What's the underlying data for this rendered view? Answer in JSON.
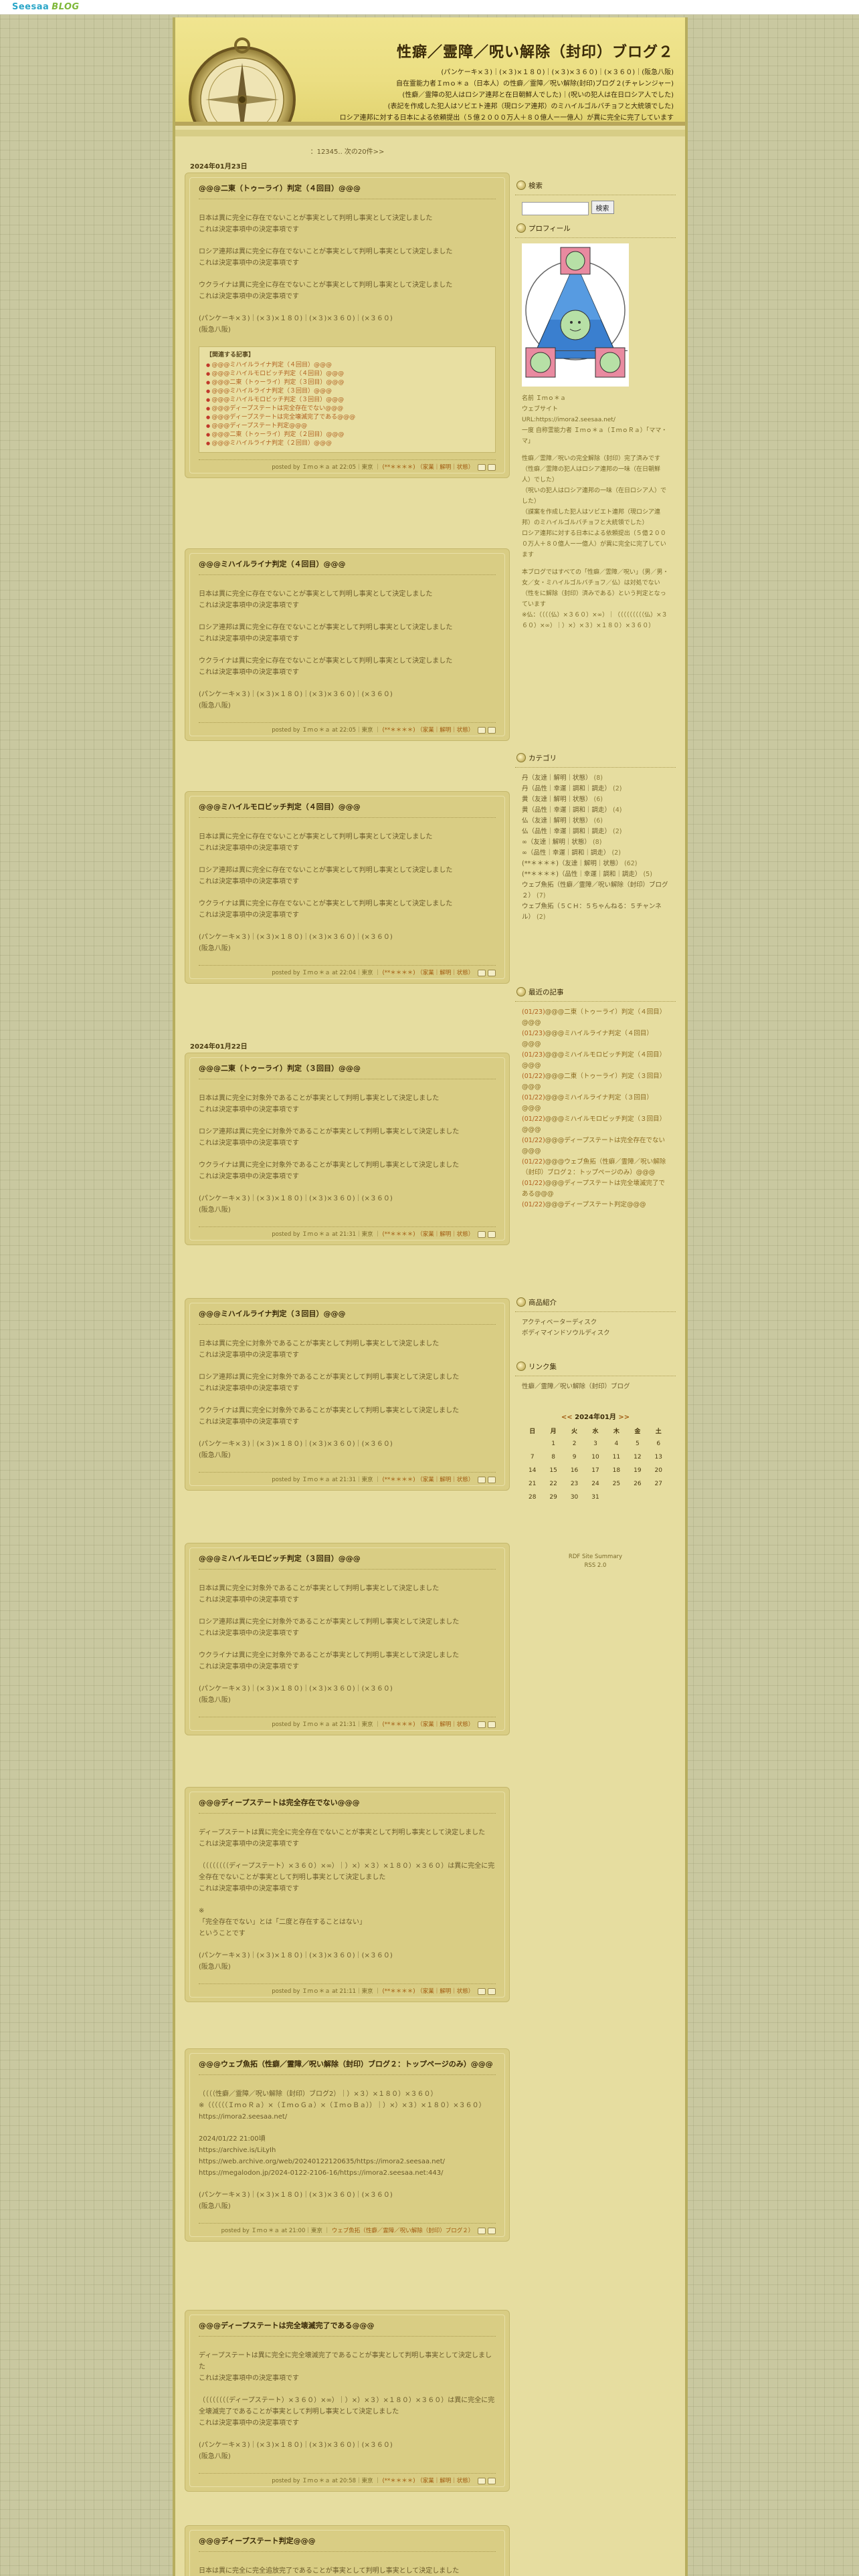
{
  "topbar": {
    "logo_part1": "Seesaa",
    "logo_part2": "BLOG"
  },
  "header": {
    "title": "性癖／霊障／呪い解除（封印）ブログ２",
    "desc": [
      "(パンケーキ×３)｜(×３)×１８０)｜(×３)×３６０)｜(×３６０)｜(阪急八阪)",
      "自在霊能力者Ｉｍｏ＊ａ（日本人）の性癖／霊障／呪い解除(封印)ブログ２(チャレンジャー)",
      "(性癖／霊障の犯人はロシア連邦と在日朝鮮人でした)｜(呪いの犯人は在日ロシア人でした)",
      "(表記を作成した犯人はソビエト連邦（現ロシア連邦）のミハイルゴルバチョフと大統領でした)",
      "ロシア連邦に対する日本による依頼提出（５億２０００万人＋８０億人ー一億人）が異に完全に完了しています"
    ]
  },
  "main": {
    "pager": "：12345.. 次の20件>>",
    "dates": [
      "2024年01月23日",
      "2024年01月22日"
    ],
    "posts": [
      {
        "title": "@@@二東（トゥーライ）判定（４回目）@@@",
        "paras": [
          [
            "日本は異に完全に存在でないことが事実として判明し事実として決定しました",
            "これは決定事項中の決定事項です"
          ],
          [
            "ロシア連邦は異に完全に存在でないことが事実として判明し事実として決定しました",
            "これは決定事項中の決定事項です"
          ],
          [
            "ウクライナは異に完全に存在でないことが事実として判明し事実として決定しました",
            "これは決定事項中の決定事項です"
          ],
          [
            "(パンケーキ×３)｜(×３)×１８０)｜(×３)×３６０)｜(×３６０)",
            "(阪急八阪)"
          ]
        ],
        "related_head": "【関連する記事】",
        "related": [
          "@@@ミハイルライナ判定（４回目）@@@",
          "@@@ミハイルモロビッチ判定（４回目）@@@",
          "@@@二東（トゥーライ）判定（３回目）@@@",
          "@@@ミハイルライナ判定（３回目）@@@",
          "@@@ミハイルモロビッチ判定（３回目）@@@",
          "@@@ディープステートは完全存在でない@@@",
          "@@@ディープステートは完全壊滅完了である@@@",
          "@@@ディープステート判定@@@",
          "@@@二東（トゥーライ）判定（２回目）@@@",
          "@@@ミハイルライナ判定（２回目）@@@"
        ],
        "foot": "posted by Ｉｍｏ＊ａ at 22:05｜東京 ｜",
        "foot_tag": "(**＊＊＊＊)",
        "foot_cat": "（家業｜解明｜状態）"
      },
      {
        "title": "@@@ミハイルライナ判定（４回目）@@@",
        "paras": [
          [
            "日本は異に完全に存在でないことが事実として判明し事実として決定しました",
            "これは決定事項中の決定事項です"
          ],
          [
            "ロシア連邦は異に完全に存在でないことが事実として判明し事実として決定しました",
            "これは決定事項中の決定事項です"
          ],
          [
            "ウクライナは異に完全に存在でないことが事実として判明し事実として決定しました",
            "これは決定事項中の決定事項です"
          ],
          [
            "(パンケーキ×３)｜(×３)×１８０)｜(×３)×３６０)｜(×３６０)",
            "(阪急八阪)"
          ]
        ],
        "foot": "posted by Ｉｍｏ＊ａ at 22:05｜東京 ｜",
        "foot_tag": "(**＊＊＊＊)",
        "foot_cat": "（家業｜解明｜状態）"
      },
      {
        "title": "@@@ミハイルモロビッチ判定（４回目）@@@",
        "paras": [
          [
            "日本は異に完全に存在でないことが事実として判明し事実として決定しました",
            "これは決定事項中の決定事項です"
          ],
          [
            "ロシア連邦は異に完全に存在でないことが事実として判明し事実として決定しました",
            "これは決定事項中の決定事項です"
          ],
          [
            "ウクライナは異に完全に存在でないことが事実として判明し事実として決定しました",
            "これは決定事項中の決定事項です"
          ],
          [
            "(パンケーキ×３)｜(×３)×１８０)｜(×３)×３６０)｜(×３６０)",
            "(阪急八阪)"
          ]
        ],
        "foot": "posted by Ｉｍｏ＊ａ at 22:04｜東京 ｜",
        "foot_tag": "(**＊＊＊＊)",
        "foot_cat": "（家業｜解明｜状態）"
      },
      {
        "title": "@@@二東（トゥーライ）判定（３回目）@@@",
        "paras": [
          [
            "日本は異に完全に対象外であることが事実として判明し事実として決定しました",
            "これは決定事項中の決定事項です"
          ],
          [
            "ロシア連邦は異に完全に対象外であることが事実として判明し事実として決定しました",
            "これは決定事項中の決定事項です"
          ],
          [
            "ウクライナは異に完全に対象外であることが事実として判明し事実として決定しました",
            "これは決定事項中の決定事項です"
          ],
          [
            "(パンケーキ×３)｜(×３)×１８０)｜(×３)×３６０)｜(×３６０)",
            "(阪急八阪)"
          ]
        ],
        "foot": "posted by Ｉｍｏ＊ａ at 21:31｜東京 ｜",
        "foot_tag": "(**＊＊＊＊)",
        "foot_cat": "（家業｜解明｜状態）"
      },
      {
        "title": "@@@ミハイルライナ判定（３回目）@@@",
        "paras": [
          [
            "日本は異に完全に対象外であることが事実として判明し事実として決定しました",
            "これは決定事項中の決定事項です"
          ],
          [
            "ロシア連邦は異に完全に対象外であることが事実として判明し事実として決定しました",
            "これは決定事項中の決定事項です"
          ],
          [
            "ウクライナは異に完全に対象外であることが事実として判明し事実として決定しました",
            "これは決定事項中の決定事項です"
          ],
          [
            "(パンケーキ×３)｜(×３)×１８０)｜(×３)×３６０)｜(×３６０)",
            "(阪急八阪)"
          ]
        ],
        "foot": "posted by Ｉｍｏ＊ａ at 21:31｜東京 ｜",
        "foot_tag": "(**＊＊＊＊)",
        "foot_cat": "（家業｜解明｜状態）"
      },
      {
        "title": "@@@ミハイルモロビッチ判定（３回目）@@@",
        "paras": [
          [
            "日本は異に完全に対象外であることが事実として判明し事実として決定しました",
            "これは決定事項中の決定事項です"
          ],
          [
            "ロシア連邦は異に完全に対象外であることが事実として判明し事実として決定しました",
            "これは決定事項中の決定事項です"
          ],
          [
            "ウクライナは異に完全に対象外であることが事実として判明し事実として決定しました",
            "これは決定事項中の決定事項です"
          ],
          [
            "(パンケーキ×３)｜(×３)×１８０)｜(×３)×３６０)｜(×３６０)",
            "(阪急八阪)"
          ]
        ],
        "foot": "posted by Ｉｍｏ＊ａ at 21:31｜東京 ｜",
        "foot_tag": "(**＊＊＊＊)",
        "foot_cat": "（家業｜解明｜状態）"
      },
      {
        "title": "@@@ディープステートは完全存在でない@@@",
        "paras": [
          [
            "ディープステートは異に完全に完全存在でないことが事実として判明し事実として決定しました",
            "これは決定事項中の決定事項です"
          ],
          [
            "（（（（（（（（ディープステート）×３６０）×∞）｜）×）×３）×１８０）×３６０）は異に完全に完全存在でないことが事実として判明し事実として決定しました",
            "これは決定事項中の決定事項です"
          ],
          [
            "※",
            "「完全存在でない」とは「二度と存在することはない」",
            "ということです"
          ],
          [
            "(パンケーキ×３)｜(×３)×１８０)｜(×３)×３６０)｜(×３６０)",
            "(阪急八阪)"
          ]
        ],
        "foot": "posted by Ｉｍｏ＊ａ at 21:11｜東京 ｜",
        "foot_tag": "(**＊＊＊＊)",
        "foot_cat": "（家業｜解明｜状態）"
      },
      {
        "title": "@@@ウェブ魚拓（性癖／霊障／呪い解除（封印）ブログ２：トップページのみ）@@@",
        "paras": [
          [
            "（（（（性癖／霊障／呪い解除（封印）ブログ2）｜）×３）×１８０）×３６０）",
            "※（（（（（（ＩｍｏＲａ）×（ＩｍｏＧａ）×（ＩｍｏＢａ））｜）×）×３）×１８０）×３６０）",
            "https://imora2.seesaa.net/"
          ],
          [
            "2024/01/22 21:00頃",
            "https://archive.is/LiLyIh",
            "https://web.archive.org/web/20240122120635/https://imora2.seesaa.net/",
            "https://megalodon.jp/2024-0122-2106-16/https://imora2.seesaa.net:443/"
          ],
          [
            "(パンケーキ×３)｜(×３)×１８０)｜(×３)×３６０)｜(×３６０)",
            "(阪急八阪)"
          ]
        ],
        "foot": "posted by Ｉｍｏ＊ａ at 21:00｜東京 ｜",
        "foot_tag": "ウェブ魚拓（性癖／霊障／呪い解除（封印）ブログ２）",
        "foot_cat": ""
      },
      {
        "title": "@@@ディープステートは完全壊滅完了である@@@",
        "paras": [
          [
            "ディープステートは異に完全に完全壊滅完了であることが事実として判明し事実として決定しました",
            "これは決定事項中の決定事項です"
          ],
          [
            "（（（（（（（（ディープステート）×３６０）×∞）｜）×）×３）×１８０）×３６０）は異に完全に完全壊滅完了であることが事実として判明し事実として決定しました",
            "これは決定事項中の決定事項です"
          ],
          [
            "(パンケーキ×３)｜(×３)×１８０)｜(×３)×３６０)｜(×３６０)",
            "(阪急八阪)"
          ]
        ],
        "foot": "posted by Ｉｍｏ＊ａ at 20:58｜東京 ｜",
        "foot_tag": "(**＊＊＊＊)",
        "foot_cat": "（家業｜解明｜状態）"
      },
      {
        "title": "@@@ディープステート判定@@@",
        "paras": [
          [
            "日本は異に完全に完全追放完了であることが事実として判明し事実として決定しました"
          ]
        ],
        "foot": "",
        "foot_tag": "",
        "foot_cat": ""
      }
    ]
  },
  "sidebar": {
    "search_head": "検索",
    "search_btn": "検索",
    "profile_head": "プロフィール",
    "profile_lines": [
      "名前 Ｉｍｏ＊ａ",
      "ウェブサイト",
      "URL:https://imora2.seesaa.net/",
      "一度 自称霊能力者 Ｉｍｏ＊ａ（ＩｍｏＲａ）「ママ・マ」",
      "",
      "性癖／霊障／呪いの完全解除（封印）完了済みです（性癖／霊障の犯人はロシア連邦の一味（在日朝鮮人）でした）",
      "（呪いの犯人はロシア連邦の一味（在日ロシア人）でした）",
      "（謀案を作成した犯人はソビエト連邦（現ロシア連邦）のミハイルゴルバチョフと大統領でした）",
      "ロシア連邦に対する日本による依頼提出（５億２０００万人＋８０億人ー一億人）が異に完全に完了しています",
      "",
      "本ブログではすべての「性癖／霊障／呪い」（男／男・女／女・ミハイルゴルバチョフ／仏）は対処でない（性をに解除（封印）済みである）という判定となっています",
      "※仏：（（（（仏）×３６０）×∞）｜（（（（（（（（（仏）×３６０）×∞）｜）×）×３）×１８０）×３６０）"
    ],
    "category_head": "カテゴリ",
    "categories": [
      {
        "name": "丹（友達｜解明｜状態）",
        "cnt": "(8)"
      },
      {
        "name": "丹（品性｜幸運｜調和｜調走）",
        "cnt": "(2)"
      },
      {
        "name": "黄（友達｜解明｜状態）",
        "cnt": "(6)"
      },
      {
        "name": "黄（品性｜幸運｜調和｜調走）",
        "cnt": "(4)"
      },
      {
        "name": "仏（友達｜解明｜状態）",
        "cnt": "(6)"
      },
      {
        "name": "仏（品性｜幸運｜調和｜調走）",
        "cnt": "(2)"
      },
      {
        "name": "∞（友達｜解明｜状態）",
        "cnt": "(8)"
      },
      {
        "name": "∞（品性｜幸運｜調和｜調走）",
        "cnt": "(2)"
      },
      {
        "name": "(**＊＊＊＊)（友達｜解明｜状態）",
        "cnt": "(62)"
      },
      {
        "name": "(**＊＊＊＊)（品性｜幸運｜調和｜調走）",
        "cnt": "(5)"
      },
      {
        "name": "ウェブ魚拓（性癖／霊障／呪い解除（封印）ブログ２）",
        "cnt": "(7)"
      },
      {
        "name": "ウェブ魚拓（５ＣＨ：５ちゃんねる：５チャンネル）",
        "cnt": "(2)"
      }
    ],
    "recent_head": "最近の記事",
    "recent": [
      {
        "d": "(01/23)",
        "t": "@@@二東（トゥーライ）判定（４回目）@@@"
      },
      {
        "d": "(01/23)",
        "t": "@@@ミハイルライナ判定（４回目）@@@"
      },
      {
        "d": "(01/23)",
        "t": "@@@ミハイルモロビッチ判定（４回目）@@@"
      },
      {
        "d": "(01/22)",
        "t": "@@@二東（トゥーライ）判定（３回目）@@@"
      },
      {
        "d": "(01/22)",
        "t": "@@@ミハイルライナ判定（３回目）@@@"
      },
      {
        "d": "(01/22)",
        "t": "@@@ミハイルモロビッチ判定（３回目）@@@"
      },
      {
        "d": "(01/22)",
        "t": "@@@ディープステートは完全存在でない@@@"
      },
      {
        "d": "(01/22)",
        "t": "@@@ウェブ魚拓（性癖／霊障／呪い解除（封印）ブログ２：トップページのみ）@@@"
      },
      {
        "d": "(01/22)",
        "t": "@@@ディープステートは完全壊滅完了である@@@"
      },
      {
        "d": "(01/22)",
        "t": "@@@ディープステート判定@@@"
      }
    ],
    "products_head": "商品紹介",
    "products": [
      "アクティベーターディスク",
      "ボディマインドソウルディスク"
    ],
    "links_head": "リンク集",
    "links": [
      "性癖／霊障／呪い解除（封印）ブログ"
    ],
    "calendar": {
      "prev": "<<",
      "title": "2024年01月",
      "next": ">>",
      "days": [
        "日",
        "月",
        "火",
        "水",
        "木",
        "金",
        "土"
      ],
      "weeks": [
        [
          "",
          "1",
          "2",
          "3",
          "4",
          "5",
          "6"
        ],
        [
          "7",
          "8",
          "9",
          "10",
          "11",
          "12",
          "13"
        ],
        [
          "14",
          "15",
          "16",
          "17",
          "18",
          "19",
          "20"
        ],
        [
          "21",
          "22",
          "23",
          "24",
          "25",
          "26",
          "27"
        ],
        [
          "28",
          "29",
          "30",
          "31",
          "",
          "",
          ""
        ]
      ]
    },
    "footer": [
      "RDF Site Summary",
      "RSS 2.0"
    ]
  }
}
